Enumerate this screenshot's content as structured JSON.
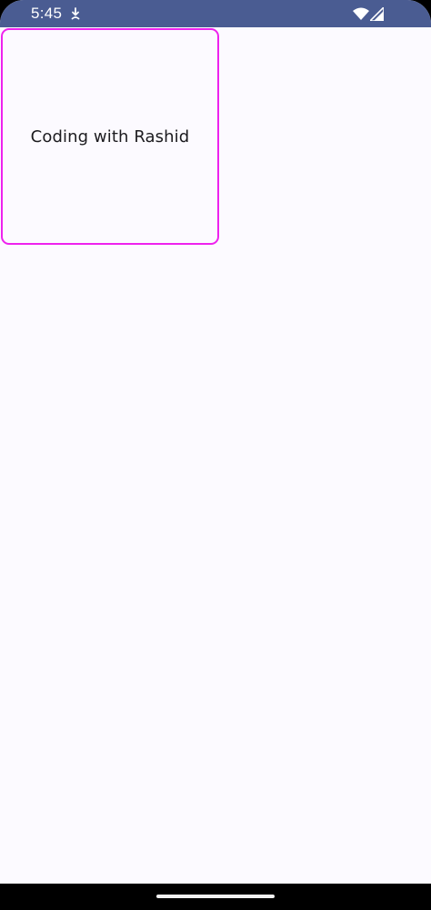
{
  "status_bar": {
    "time": "5:45",
    "icons": [
      "download-icon",
      "wifi-icon",
      "cell-signal-icon"
    ],
    "background": "#4a5c92"
  },
  "card": {
    "text": "Coding with Rashid",
    "border_color": "#ee22ee"
  },
  "screen": {
    "background": "#fcfaff"
  }
}
